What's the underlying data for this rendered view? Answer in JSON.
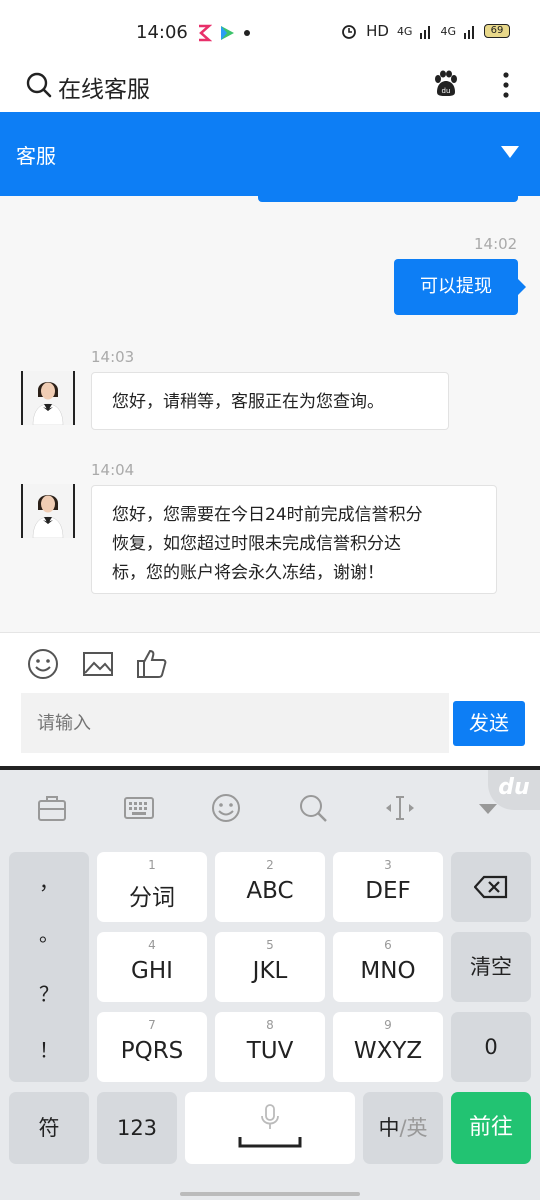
{
  "status_bar": {
    "time": "14:06",
    "network": "HD",
    "signal1": "4G",
    "signal2": "4G",
    "battery": "69"
  },
  "header": {
    "title": "在线客服"
  },
  "service_bar": {
    "label": "客服"
  },
  "colors": {
    "primary_blue": "#0d7ef5",
    "go_green": "#22c372"
  },
  "chat": {
    "messages": [
      {
        "side": "right",
        "time": "14:02",
        "text": "可以提现"
      },
      {
        "side": "left",
        "time": "14:03",
        "text": "您好，请稍等，客服正在为您查询。"
      },
      {
        "side": "left",
        "time": "14:04",
        "lines": [
          "您好，您需要在今日24时前完成信誉积分",
          "恢复，如您超过时限未完成信誉积分达",
          "标，您的账户将会永久冻结，谢谢！"
        ]
      }
    ]
  },
  "input": {
    "placeholder": "请输入",
    "send_label": "发送"
  },
  "keyboard": {
    "brand_badge": "du",
    "punctuation": [
      "，",
      "。",
      "？",
      "！"
    ],
    "keys": [
      {
        "num": "1",
        "label": "分词"
      },
      {
        "num": "2",
        "label": "ABC"
      },
      {
        "num": "3",
        "label": "DEF"
      },
      {
        "num": "4",
        "label": "GHI"
      },
      {
        "num": "5",
        "label": "JKL"
      },
      {
        "num": "6",
        "label": "MNO"
      },
      {
        "num": "7",
        "label": "PQRS"
      },
      {
        "num": "8",
        "label": "TUV"
      },
      {
        "num": "9",
        "label": "WXYZ"
      }
    ],
    "clear_label": "清空",
    "zero_label": "0",
    "symbol_label": "符",
    "numeric_label": "123",
    "lang_label_a": "中",
    "lang_label_sep": "/",
    "lang_label_b": "英",
    "go_label": "前往"
  }
}
